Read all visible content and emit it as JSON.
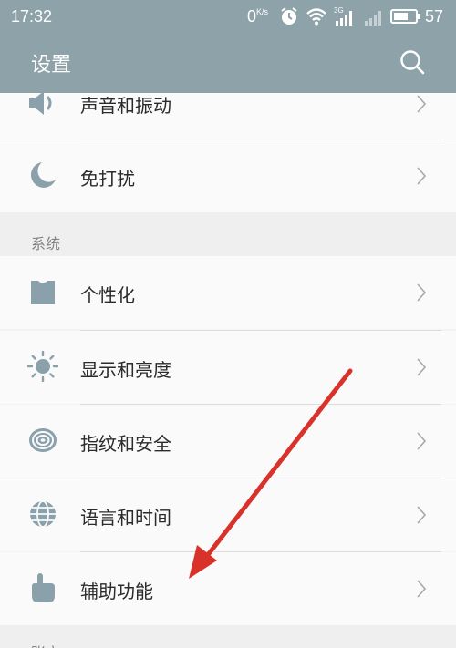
{
  "status_bar": {
    "time": "17:32",
    "net_speed_value": "0",
    "net_speed_unit": "K/s",
    "battery": "57",
    "icons": [
      "alarm-icon",
      "wifi-icon",
      "signal-3g-icon",
      "signal-icon",
      "battery-icon"
    ]
  },
  "app_bar": {
    "title": "设置",
    "search_icon": "search-icon"
  },
  "rows_top": [
    {
      "label": "声音和振动",
      "icon": "speaker-icon"
    },
    {
      "label": "免打扰",
      "icon": "moon-icon"
    }
  ],
  "section_system": {
    "title": "系统"
  },
  "rows_system": [
    {
      "label": "个性化",
      "icon": "shirt-icon"
    },
    {
      "label": "显示和亮度",
      "icon": "sun-icon"
    },
    {
      "label": "指纹和安全",
      "icon": "fingerprint-icon"
    },
    {
      "label": "语言和时间",
      "icon": "globe-icon"
    },
    {
      "label": "辅助功能",
      "icon": "hand-pointer-icon"
    }
  ],
  "section_account": {
    "title": "账户"
  },
  "colors": {
    "header_bg": "#8ea2aa",
    "icon_color": "#8aa1ac",
    "annotation_arrow": "#d9322b"
  }
}
